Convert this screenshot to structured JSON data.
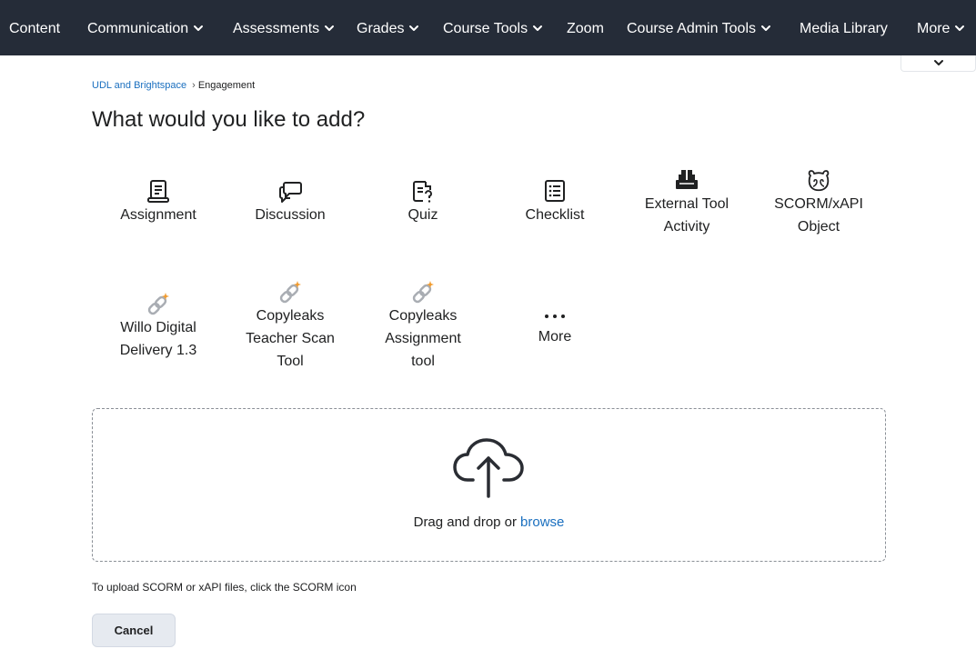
{
  "navbar": {
    "items": [
      {
        "label": "Content",
        "dropdown": false
      },
      {
        "label": "Communication",
        "dropdown": true
      },
      {
        "label": "Assessments",
        "dropdown": true
      },
      {
        "label": "Grades",
        "dropdown": true
      },
      {
        "label": "Course Tools",
        "dropdown": true
      },
      {
        "label": "Zoom",
        "dropdown": false
      },
      {
        "label": "Course Admin Tools",
        "dropdown": true
      },
      {
        "label": "Media Library",
        "dropdown": false
      },
      {
        "label": "More",
        "dropdown": true
      }
    ],
    "background": "#252c38"
  },
  "breadcrumb": {
    "parent": "UDL and Brightspace",
    "separator": "›",
    "current": "Engagement"
  },
  "page_title": "What would you like to add?",
  "tiles_row1": [
    {
      "icon": "assignment-icon",
      "lines": [
        "Assignment"
      ]
    },
    {
      "icon": "discussion-icon",
      "lines": [
        "Discussion"
      ]
    },
    {
      "icon": "quiz-icon",
      "lines": [
        "Quiz"
      ]
    },
    {
      "icon": "checklist-icon",
      "lines": [
        "Checklist"
      ]
    },
    {
      "icon": "external-tool-icon",
      "lines": [
        "External Tool",
        "Activity"
      ]
    },
    {
      "icon": "scorm-icon",
      "lines": [
        "SCORM/xAPI",
        "Object"
      ]
    }
  ],
  "tiles_row2": [
    {
      "icon": "lti-link-icon",
      "lines": [
        "Willo Digital",
        "Delivery 1.3"
      ]
    },
    {
      "icon": "lti-link-icon",
      "lines": [
        "Copyleaks",
        "Teacher Scan",
        "Tool"
      ]
    },
    {
      "icon": "lti-link-icon",
      "lines": [
        "Copyleaks",
        "Assignment",
        "tool"
      ]
    },
    {
      "icon": "more-dots-icon",
      "lines": [
        "More"
      ]
    }
  ],
  "dropzone": {
    "text": "Drag and drop or",
    "browse_label": "browse"
  },
  "hint": "To upload SCORM or xAPI files, click the SCORM icon",
  "cancel_label": "Cancel",
  "colors": {
    "link": "#1a6fbf",
    "accent_orange": "#f29b2e",
    "text": "#202122"
  }
}
